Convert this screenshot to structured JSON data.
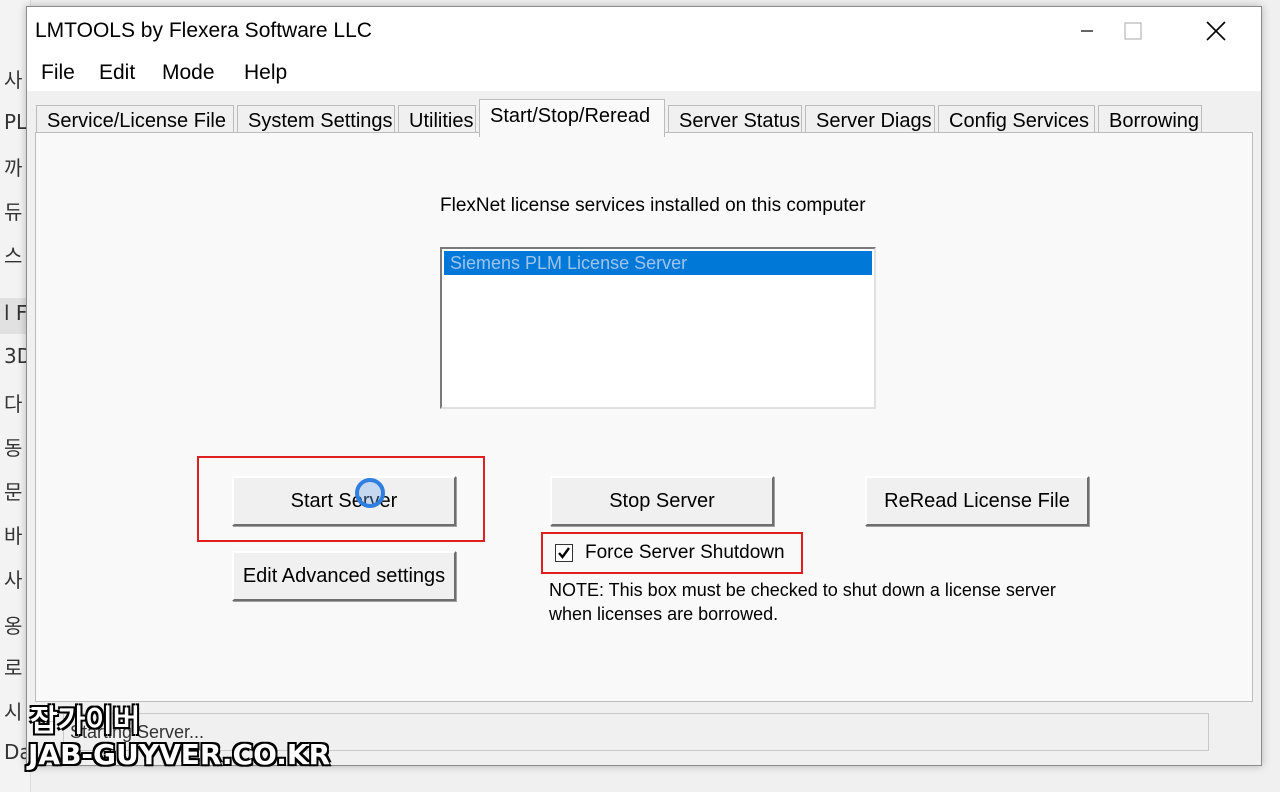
{
  "background_app": {
    "side_chars": [
      "사",
      "PL",
      "까",
      "듀",
      "스",
      "l F",
      "3D",
      "다",
      "동",
      "문",
      "바",
      "사",
      "옹",
      "로",
      "시",
      "Da"
    ]
  },
  "window": {
    "title": "LMTOOLS by Flexera Software LLC"
  },
  "menu": {
    "items": [
      "File",
      "Edit",
      "Mode",
      "Help"
    ]
  },
  "tabs": [
    {
      "label": "Service/License File",
      "active": false
    },
    {
      "label": "System Settings",
      "active": false
    },
    {
      "label": "Utilities",
      "active": false
    },
    {
      "label": "Start/Stop/Reread",
      "active": true
    },
    {
      "label": "Server Status",
      "active": false
    },
    {
      "label": "Server Diags",
      "active": false
    },
    {
      "label": "Config Services",
      "active": false
    },
    {
      "label": "Borrowing",
      "active": false
    }
  ],
  "panel": {
    "services_label": "FlexNet license services installed on this computer",
    "services": [
      "Siemens PLM License Server"
    ],
    "start_button": "Start Server",
    "stop_button": "Stop Server",
    "reread_button": "ReRead License File",
    "edit_advanced_button": "Edit Advanced settings",
    "force_shutdown_label": "Force Server Shutdown",
    "force_shutdown_checked": true,
    "note_line1": "NOTE:  This box must be checked to shut down a license server",
    "note_line2": "when licenses are borrowed."
  },
  "status": {
    "text": "Starting Server..."
  },
  "watermark": {
    "line1": "잡가이버",
    "line2": "JAB-GUYVER.CO.KR"
  },
  "colors": {
    "highlight_box": "#e02020",
    "selection": "#0078d7"
  }
}
